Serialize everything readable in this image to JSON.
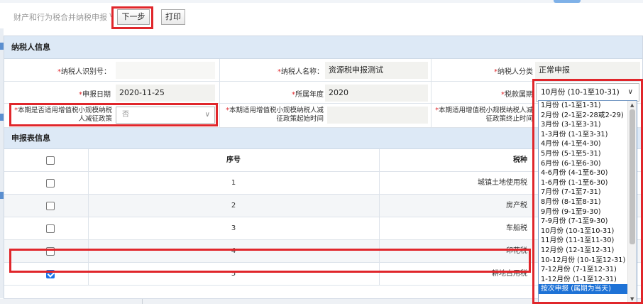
{
  "toolbar": {
    "breadcrumb": "财产和行为税合并纳税申报",
    "next_label": "下一步",
    "print_label": "打印"
  },
  "taxpayer": {
    "section_title": "纳税人信息",
    "id_label": "纳税人识别号：",
    "id_value": "",
    "name_label": "纳税人名称：",
    "name_value": "资源税申报测试",
    "category_label": "纳税人分类",
    "category_value": "正常申报",
    "date_label": "申报日期",
    "date_value": "2020-11-25",
    "year_label": "所属年度",
    "year_value": "2020",
    "period_label": "税款属期",
    "period_value": "10月份 (10-1至10-31)",
    "small_policy_label": "本期是否适用增值税小规模纳税人减征政策",
    "small_policy_value": "否",
    "policy_start_label": "本期适用增值税小规模纳税人减征政策起始时间",
    "policy_start_value": "",
    "policy_end_label": "本期适用增值税小规模纳税人减征政策终止时间"
  },
  "declaration": {
    "section_title": "申报表信息",
    "headers": {
      "seq": "序号",
      "tax": "税种"
    },
    "rows": [
      {
        "seq": "1",
        "tax": "城镇土地使用税",
        "checked": false
      },
      {
        "seq": "2",
        "tax": "房产税",
        "checked": false
      },
      {
        "seq": "3",
        "tax": "车船税",
        "checked": false
      },
      {
        "seq": "4",
        "tax": "印花税",
        "checked": false
      },
      {
        "seq": "5",
        "tax": "耕地占用税",
        "checked": true
      }
    ]
  },
  "period_options": [
    "1月份 (1-1至1-31)",
    "2月份 (2-1至2-28或2-29)",
    "3月份 (3-1至3-31)",
    "1-3月份 (1-1至3-31)",
    "4月份 (4-1至4-30)",
    "5月份 (5-1至5-31)",
    "6月份 (6-1至6-30)",
    "4-6月份 (4-1至6-30)",
    "1-6月份 (1-1至6-30)",
    "7月份 (7-1至7-31)",
    "8月份 (8-1至8-31)",
    "9月份 (9-1至9-30)",
    "7-9月份 (7-1至9-30)",
    "10月份 (10-1至10-31)",
    "11月份 (11-1至11-30)",
    "12月份 (12-1至12-31)",
    "10-12月份 (10-1至12-31)",
    "7-12月份 (7-1至12-31)",
    "1-12月份 (1-1至12-31)",
    "按次申报 (属期为当天)"
  ],
  "period_selected_index": 19,
  "colors": {
    "highlight": "#e0262b",
    "header_bg": "#dde9f6",
    "selected_bg": "#1e72d6"
  }
}
